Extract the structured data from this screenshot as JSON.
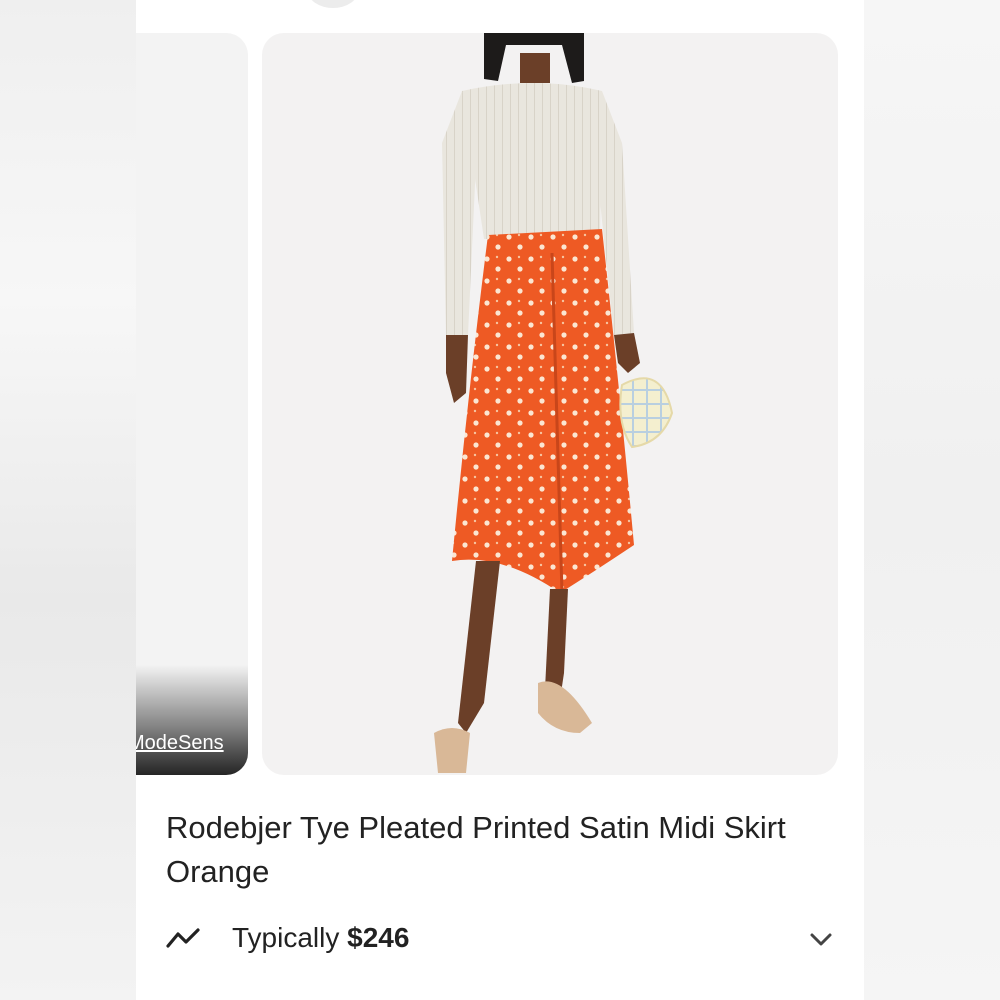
{
  "carousel": {
    "prev_card": {
      "source_label": "ModeSens"
    },
    "main_card": {
      "image": "product-photo"
    }
  },
  "product": {
    "title": "Rodebjer Tye Pleated Printed Satin Midi Skirt Orange"
  },
  "price": {
    "prefix": "Typically",
    "value": "$246"
  },
  "icons": {
    "trend": "price-trend-icon",
    "expand": "chevron-down-icon"
  },
  "colors": {
    "skirt": "#ee5a24",
    "sweater": "#e8e4dc",
    "text": "#222222"
  }
}
